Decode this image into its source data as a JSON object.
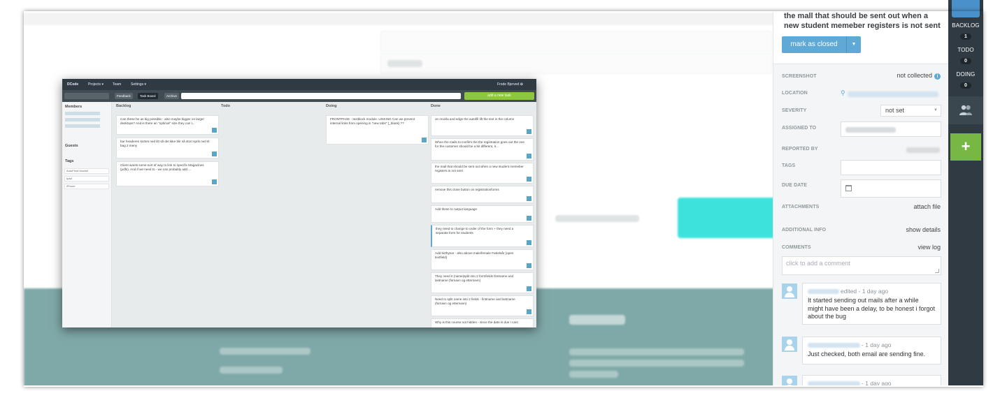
{
  "board": {
    "nav": {
      "brand": "DCode",
      "projects": "Projects ▾",
      "team": "Team",
      "settings": "Settings ▾",
      "user": "Frode Bjerved ✿"
    },
    "toolbar": {
      "tabs": [
        "Feedback",
        "Task Board",
        "Archive"
      ],
      "add_task": "add a new task"
    },
    "sidebar": {
      "members": "Members",
      "guests": "Guests",
      "tags_heading": "Tags",
      "tags": [
        "AutoFeed blocker",
        "Ipad",
        "iPhone"
      ]
    },
    "columns": [
      "Backlog",
      "Todo",
      "Doing",
      "Done"
    ],
    "backlog_cards": [
      "Can these be as big possible - also maybe bigger on larger desktops? And is there an \"optimal\" size they can t...",
      "bar headeren kortes ned litt så det ikke blir så stort sprik ned til bag 2 meny",
      "Client wants some sort of way to link to specific Magazines (pdfs). And if we need to - we can probably add ..."
    ],
    "doing_cards": [
      "FRONTPAGE - textblock module. LINKING Can we prevent internal links from opening in \"new tabs\" (_blank) ??"
    ],
    "done_cards": [
      "on mozila and edge the autofill lift the text in the column",
      "When the mails to confirm the the registration goes out the one for the customer should be a bit different, it...",
      "the mail that should be sent out when a new student memeber registers is not sent",
      "remove this close button on registrationforms",
      "Add these to output language",
      "they need to change to order of the form + they need a separate form for students",
      "Add birthyear - also above male/female Fødelsår (open textfield)",
      "They need it (name)split into 2 formfields firstname and lastname (fornavn og etternavn)",
      "Need to split name into 2 fields - firstname and lastname (fornavn og etternavn)",
      "Why is this course not hidden - since the date is due I cant"
    ]
  },
  "panel": {
    "title": "the mall that should be sent out when a new student memeber registers is not sent",
    "mark_button": "mark as closed",
    "fields": {
      "screenshot_label": "SCREENSHOT",
      "screenshot_value": "not collected",
      "location_label": "LOCATION",
      "severity_label": "SEVERITY",
      "severity_value": "not set",
      "assigned_label": "ASSIGNED TO",
      "reported_label": "REPORTED BY",
      "tags_label": "TAGS",
      "due_label": "DUE DATE",
      "attachments_label": "ATTACHMENTS",
      "attachments_value": "attach file",
      "additional_label": "ADDITIONAL INFO",
      "additional_value": "show details",
      "comments_label": "COMMENTS",
      "comments_value": "view log"
    },
    "comment_placeholder": "click to add a comment",
    "comments": [
      {
        "meta": "edited - 1 day ago",
        "body": "It started sending out mails after a while might have been a delay, to be honest i forgot about the bug"
      },
      {
        "meta": "- 1 day ago",
        "body": "Just checked, both email are sending fine."
      },
      {
        "meta": "- 1 day ago",
        "body": ""
      }
    ]
  },
  "rail": {
    "stats": [
      {
        "name": "BACKLOG",
        "count": "1"
      },
      {
        "name": "TODO",
        "count": "0"
      },
      {
        "name": "DOING",
        "count": "0"
      }
    ],
    "add_label": "+"
  }
}
